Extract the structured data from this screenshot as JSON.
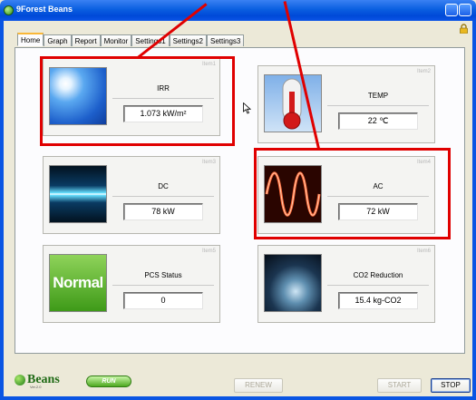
{
  "window": {
    "title": "9Forest Beans"
  },
  "tabs": [
    "Home",
    "Graph",
    "Report",
    "Monitor",
    "Settings1",
    "Settings2",
    "Settings3"
  ],
  "cards": [
    {
      "tag": "Item1",
      "title": "IRR",
      "value": "1.073  kW/m²"
    },
    {
      "tag": "Item2",
      "title": "TEMP",
      "value": "22  ℃"
    },
    {
      "tag": "Item3",
      "title": "DC",
      "value": "78  kW"
    },
    {
      "tag": "Item4",
      "title": "AC",
      "value": "72  kW"
    },
    {
      "tag": "Item5",
      "title": "PCS Status",
      "value": "0",
      "badge": "Normal"
    },
    {
      "tag": "Item6",
      "title": "CO2 Reduction",
      "value": "15.4  kg-CO2"
    }
  ],
  "footer": {
    "logo": "Beans",
    "version": "Ver.2.0",
    "run_badge": "RUN",
    "renew": "RENEW",
    "start": "START",
    "stop": "STOP"
  },
  "colors": {
    "highlight": "#e00000",
    "titlebar": "#0a54e6"
  }
}
